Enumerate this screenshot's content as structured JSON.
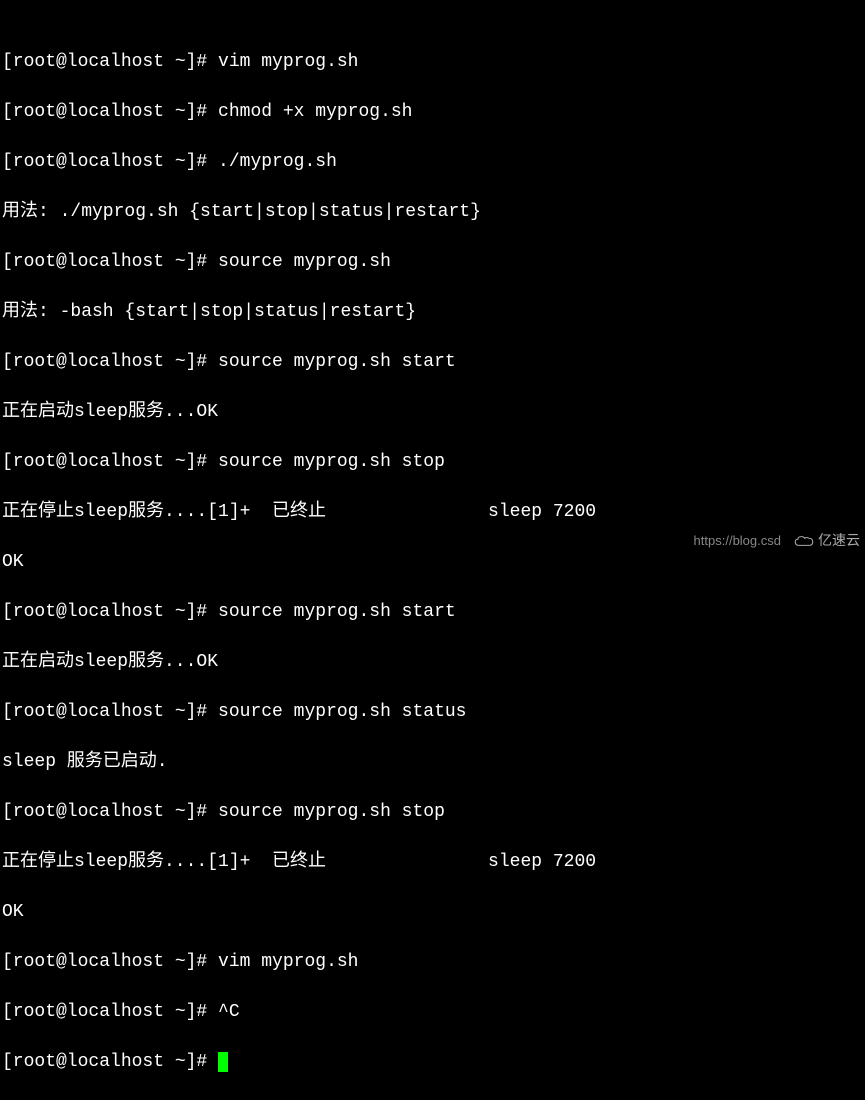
{
  "prompt": "[root@localhost ~]# ",
  "lines": {
    "l1": "vim myprog.sh",
    "l2": "chmod +x myprog.sh",
    "l3": "./myprog.sh",
    "l4": "用法: ./myprog.sh {start|stop|status|restart}",
    "l5": "source myprog.sh",
    "l6": "用法: -bash {start|stop|status|restart}",
    "l7": "source myprog.sh start",
    "l8": "正在启动sleep服务...OK",
    "l9": "source myprog.sh stop",
    "l10": "正在停止sleep服务....[1]+  已终止               sleep 7200",
    "l11": "OK",
    "l12": "source myprog.sh start",
    "l13": "正在启动sleep服务...OK",
    "l14": "source myprog.sh status",
    "l15": "sleep 服务已启动.",
    "l16": "source myprog.sh stop",
    "l17": "正在停止sleep服务....[1]+  已终止               sleep 7200",
    "l18": "OK",
    "l19": "vim myprog.sh",
    "l20": "^C",
    "l21": ""
  },
  "watermark": {
    "url": "https://blog.csd",
    "brand": "亿速云"
  }
}
